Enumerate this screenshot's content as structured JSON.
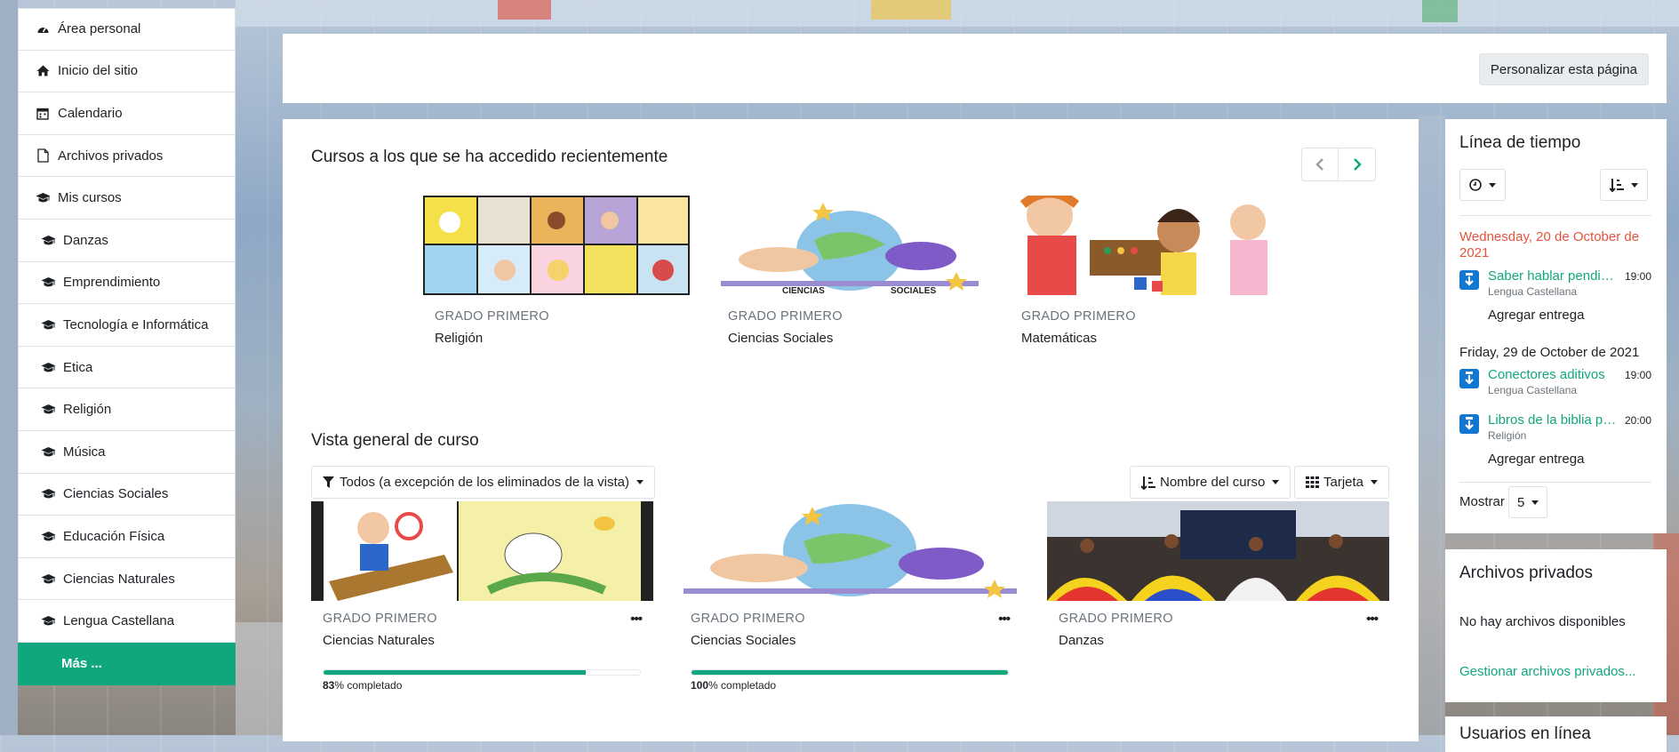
{
  "nav": {
    "items": [
      {
        "label": "Área personal",
        "icon": "dashboard-icon"
      },
      {
        "label": "Inicio del sitio",
        "icon": "home-icon"
      },
      {
        "label": "Calendario",
        "icon": "calendar-icon"
      },
      {
        "label": "Archivos privados",
        "icon": "file-icon"
      },
      {
        "label": "Mis cursos",
        "icon": "graduation-cap-icon"
      },
      {
        "label": "Danzas",
        "icon": "graduation-cap-icon"
      },
      {
        "label": "Emprendimiento",
        "icon": "graduation-cap-icon"
      },
      {
        "label": "Tecnología e Informática",
        "icon": "graduation-cap-icon"
      },
      {
        "label": "Etica",
        "icon": "graduation-cap-icon"
      },
      {
        "label": "Religión",
        "icon": "graduation-cap-icon"
      },
      {
        "label": "Música",
        "icon": "graduation-cap-icon"
      },
      {
        "label": "Ciencias Sociales",
        "icon": "graduation-cap-icon"
      },
      {
        "label": "Educación Física",
        "icon": "graduation-cap-icon"
      },
      {
        "label": "Ciencias Naturales",
        "icon": "graduation-cap-icon"
      },
      {
        "label": "Lengua Castellana",
        "icon": "graduation-cap-icon"
      }
    ],
    "more": "Más ..."
  },
  "header": {
    "customize_label": "Personalizar esta página"
  },
  "recent": {
    "title": "Cursos a los que se ha accedido recientemente",
    "courses": [
      {
        "category": "GRADO PRIMERO",
        "name": "Religión"
      },
      {
        "category": "GRADO PRIMERO",
        "name": "Ciencias Sociales"
      },
      {
        "category": "GRADO PRIMERO",
        "name": "Matemáticas"
      }
    ],
    "collage_text": [
      "CIENCIAS",
      "SOCIALES"
    ]
  },
  "overview": {
    "title": "Vista general de curso",
    "filter_label": "Todos (a excepción de los eliminados de la vista)",
    "sort_label": "Nombre del curso",
    "view_label": "Tarjeta",
    "courses": [
      {
        "category": "GRADO PRIMERO",
        "name": "Ciencias Naturales",
        "progress": 83,
        "progress_suffix": "% completado"
      },
      {
        "category": "GRADO PRIMERO",
        "name": "Ciencias Sociales",
        "progress": 100,
        "progress_suffix": "% completado"
      },
      {
        "category": "GRADO PRIMERO",
        "name": "Danzas"
      }
    ]
  },
  "timeline": {
    "title": "Línea de tiempo",
    "groups": [
      {
        "date": "Wednesday, 20 de October de 2021",
        "overdue_color": "#e5533d",
        "events": [
          {
            "name": "Saber hablar pendiente",
            "course": "Lengua Castellana",
            "time": "19:00",
            "action": "Agregar entrega"
          }
        ]
      },
      {
        "date": "Friday, 29 de October de 2021",
        "events": [
          {
            "name": "Conectores aditivos",
            "course": "Lengua Castellana",
            "time": "19:00"
          },
          {
            "name": "Libros de la biblia parte",
            "course": "Religión",
            "time": "20:00",
            "action": "Agregar entrega"
          }
        ]
      }
    ],
    "show_label": "Mostrar",
    "show_value": "5"
  },
  "private_files": {
    "title": "Archivos privados",
    "empty": "No hay archivos disponibles",
    "manage": "Gestionar archivos privados..."
  },
  "online_users": {
    "title": "Usuarios en línea"
  },
  "colors": {
    "accent": "#11a77e",
    "overdue": "#e5533d",
    "assign_icon": "#1177d1"
  }
}
